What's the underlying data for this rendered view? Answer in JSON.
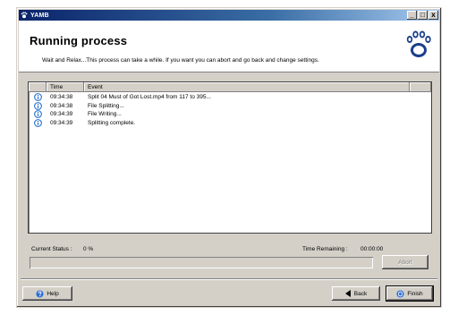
{
  "window": {
    "title": "YAMB",
    "buttons": {
      "minimize": "_",
      "maximize": "□",
      "close": "x"
    }
  },
  "header": {
    "title": "Running process",
    "subtitle": "Wait and Relax...This process can take a while. If you want you can abort and go back and change settings.",
    "logo_icon": "paw-print-icon"
  },
  "log": {
    "columns": [
      "",
      "Time",
      "Event"
    ],
    "rows": [
      {
        "icon": "info-icon",
        "time": "09:34:38",
        "event": "Split 04 Must of Got Lost.mp4 from 117 to 395..."
      },
      {
        "icon": "info-icon",
        "time": "09:34:38",
        "event": "File Splitting..."
      },
      {
        "icon": "info-icon",
        "time": "09:34:39",
        "event": "File Writing..."
      },
      {
        "icon": "info-icon",
        "time": "09:34:39",
        "event": "Splitting complete."
      }
    ]
  },
  "status": {
    "current_label": "Current Status :",
    "current_value": "0 %",
    "remaining_label": "Time Remaining :",
    "remaining_value": "00:00:00",
    "progress_percent": 0
  },
  "buttons": {
    "abort": "Abort",
    "help": "Help",
    "back": "Back",
    "finish": "Finish"
  },
  "colors": {
    "titlebar": "#0a246a",
    "info_icon": "#1f6fd0",
    "paw_logo": "#1a3f8c"
  }
}
